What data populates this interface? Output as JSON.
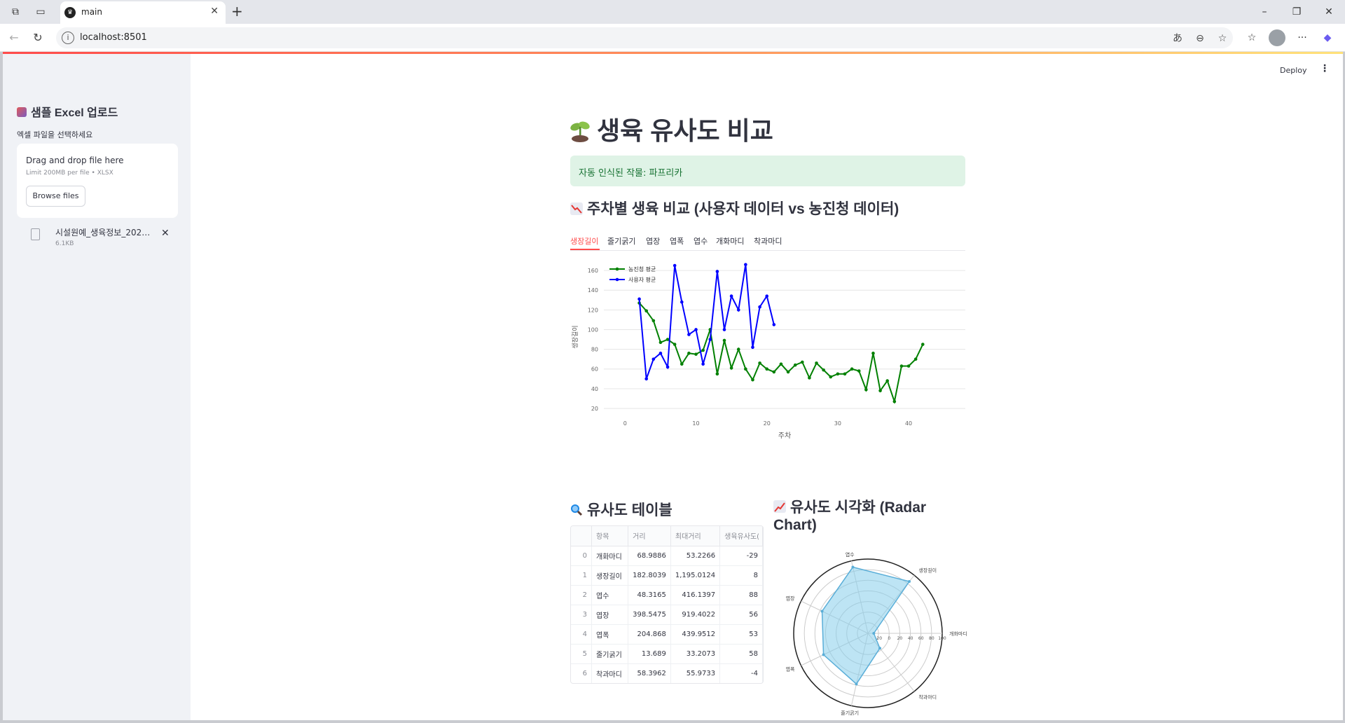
{
  "browser": {
    "tab_title": "main",
    "url": "localhost:8501"
  },
  "sidebar": {
    "title": "샘플 Excel 업로드",
    "uploader_label": "엑셀 파일을 선택하세요",
    "dropzone_title": "Drag and drop file here",
    "dropzone_sub": "Limit 200MB per file • XLSX",
    "browse_label": "Browse files",
    "file_name": "시설원예_생육정보_2025...",
    "file_size": "6.1KB"
  },
  "header": {
    "deploy_label": "Deploy"
  },
  "main": {
    "title": "생육 유사도 비교",
    "success_msg": "자동 인식된 작물: 파프리카",
    "section1_title": "주차별 생육 비교 (사용자 데이터 vs 농진청 데이터)",
    "tabs": [
      "생장길이",
      "줄기굵기",
      "엽장",
      "엽폭",
      "엽수",
      "개화마디",
      "착과마디"
    ],
    "section2_title": "유사도 테이블",
    "section3_title_line1": "유사도 시각화 (Radar",
    "section3_title_line2": "Chart)"
  },
  "table": {
    "headers": [
      "",
      "항목",
      "거리",
      "최대거리",
      "생육유사도("
    ],
    "rows": [
      [
        "0",
        "개화마디",
        "68.9886",
        "53.2266",
        "-29"
      ],
      [
        "1",
        "생장길이",
        "182.8039",
        "1,195.0124",
        "8"
      ],
      [
        "2",
        "엽수",
        "48.3165",
        "416.1397",
        "88"
      ],
      [
        "3",
        "엽장",
        "398.5475",
        "919.4022",
        "56"
      ],
      [
        "4",
        "엽폭",
        "204.868",
        "439.9512",
        "53"
      ],
      [
        "5",
        "줄기굵기",
        "13.689",
        "33.2073",
        "58"
      ],
      [
        "6",
        "착과마디",
        "58.3962",
        "55.9733",
        "-4"
      ]
    ]
  },
  "chart_data": [
    {
      "type": "line",
      "xlabel": "주차",
      "ylabel": "생장길이",
      "xlim": [
        -3,
        48
      ],
      "ylim": [
        15,
        170
      ],
      "xticks": [
        0,
        10,
        20,
        30,
        40
      ],
      "yticks": [
        20,
        40,
        60,
        80,
        100,
        120,
        140,
        160
      ],
      "grid": true,
      "legend_position": "top-left",
      "series": [
        {
          "name": "농진청 평균",
          "color": "#008000",
          "x": [
            2,
            3,
            4,
            5,
            6,
            7,
            8,
            9,
            10,
            11,
            12,
            13,
            14,
            15,
            16,
            17,
            18,
            19,
            20,
            21,
            22,
            23,
            24,
            25,
            26,
            27,
            28,
            29,
            30,
            31,
            32,
            33,
            34,
            35,
            36,
            37,
            38,
            39,
            40,
            41,
            42
          ],
          "y": [
            127,
            119,
            109,
            87,
            90,
            85,
            65,
            76,
            75,
            79,
            100,
            55,
            89,
            61,
            80,
            60,
            49,
            66,
            60,
            57,
            65,
            57,
            64,
            67,
            51,
            66,
            59,
            52,
            55,
            55,
            60,
            58,
            39,
            76,
            38,
            48,
            27,
            63,
            63,
            70,
            85
          ]
        },
        {
          "name": "사용자 평균",
          "color": "#0000ff",
          "x": [
            2,
            3,
            4,
            5,
            6,
            7,
            8,
            9,
            10,
            11,
            12,
            13,
            14,
            15,
            16,
            17,
            18,
            19,
            20,
            21
          ],
          "y": [
            131,
            50,
            70,
            76,
            62,
            165,
            128,
            95,
            100,
            65,
            90,
            159,
            100,
            134,
            120,
            166,
            82,
            123,
            134,
            105
          ]
        }
      ]
    },
    {
      "type": "radar",
      "axes": [
        "개화마디",
        "생장길이",
        "엽수",
        "엽장",
        "엽폭",
        "줄기굵기",
        "착과마디"
      ],
      "values": [
        -29,
        85,
        88,
        56,
        53,
        58,
        -4
      ],
      "rlim": [
        -40,
        100
      ],
      "rticks": [
        -20,
        0,
        20,
        40,
        60,
        80,
        100
      ],
      "color": "#87ceeb"
    }
  ]
}
